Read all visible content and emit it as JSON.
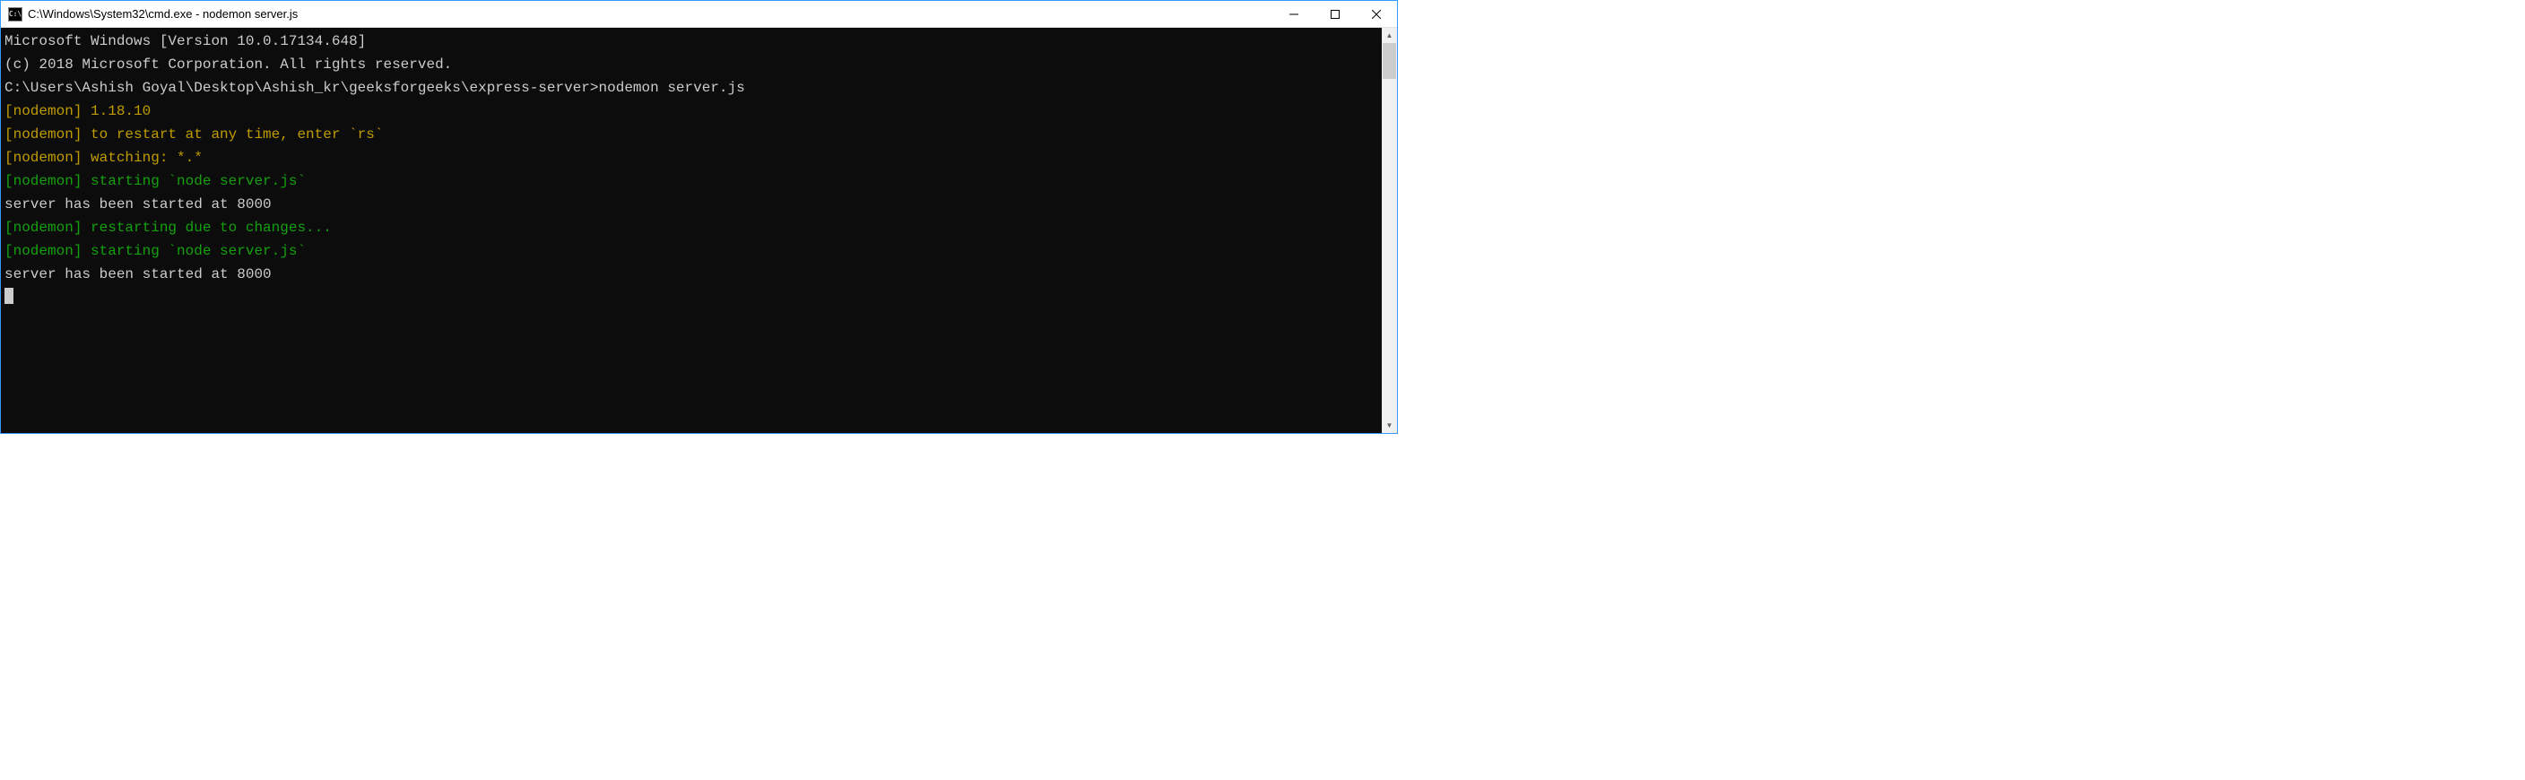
{
  "window": {
    "title": "C:\\Windows\\System32\\cmd.exe - nodemon  server.js",
    "icon_text": "C:\\"
  },
  "terminal": {
    "lines": [
      {
        "cls": "c-white",
        "text": "Microsoft Windows [Version 10.0.17134.648]"
      },
      {
        "cls": "c-white",
        "text": "(c) 2018 Microsoft Corporation. All rights reserved."
      },
      {
        "cls": "c-white",
        "text": ""
      },
      {
        "cls": "c-white",
        "text": "C:\\Users\\Ashish Goyal\\Desktop\\Ashish_kr\\geeksforgeeks\\express-server>nodemon server.js"
      },
      {
        "cls": "c-yellow",
        "text": "[nodemon] 1.18.10"
      },
      {
        "cls": "c-yellow",
        "text": "[nodemon] to restart at any time, enter `rs`"
      },
      {
        "cls": "c-yellow",
        "text": "[nodemon] watching: *.*"
      },
      {
        "cls": "c-green",
        "text": "[nodemon] starting `node server.js`"
      },
      {
        "cls": "c-white",
        "text": "server has been started at 8000"
      },
      {
        "cls": "c-green",
        "text": "[nodemon] restarting due to changes..."
      },
      {
        "cls": "c-green",
        "text": "[nodemon] starting `node server.js`"
      },
      {
        "cls": "c-white",
        "text": "server has been started at 8000"
      }
    ]
  }
}
